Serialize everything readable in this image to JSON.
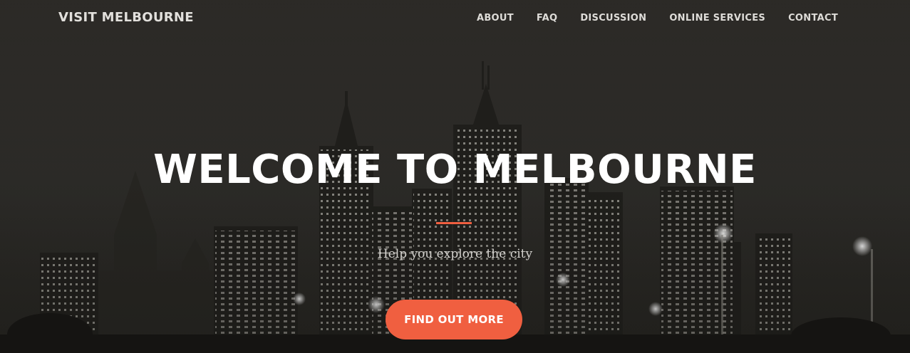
{
  "navbar": {
    "brand": "VISIT MELBOURNE",
    "links": [
      {
        "label": "ABOUT"
      },
      {
        "label": "FAQ"
      },
      {
        "label": "DISCUSSION"
      },
      {
        "label": "ONLINE SERVICES"
      },
      {
        "label": "CONTACT"
      }
    ]
  },
  "hero": {
    "heading": "WELCOME TO MELBOURNE",
    "tagline": "Help you explore the city",
    "cta_label": "FIND OUT MORE",
    "background_image": "night-city-skyline-grayscale",
    "accent_color": "#f05f40"
  }
}
